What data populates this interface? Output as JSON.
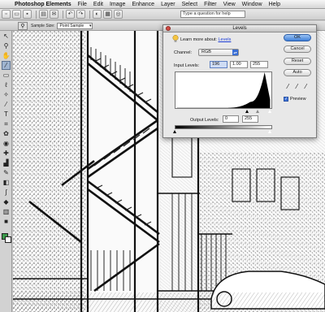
{
  "menubar": {
    "apple": "",
    "items": [
      "Photoshop Elements",
      "File",
      "Edit",
      "Image",
      "Enhance",
      "Layer",
      "Select",
      "Filter",
      "View",
      "Window",
      "Help"
    ]
  },
  "shortcuts": {
    "help_placeholder": "Type a question for help"
  },
  "options": {
    "sample_size_label": "Sample Size:",
    "sample_size_value": "Point Sample"
  },
  "levels": {
    "title": "Levels",
    "learn_more_prefix": "Learn more about:",
    "learn_more_link": "Levels",
    "channel_label": "Channel:",
    "channel_value": "RGB",
    "input_levels_label": "Input Levels:",
    "input_black": "196",
    "input_gamma": "1.00",
    "input_white": "255",
    "output_levels_label": "Output Levels:",
    "output_black": "0",
    "output_white": "255",
    "buttons": {
      "ok": "OK",
      "cancel": "Cancel",
      "reset": "Reset",
      "auto": "Auto"
    },
    "preview_label": "Preview",
    "preview_checked": true
  },
  "colors": {
    "accent": "#3a6fd6",
    "foreground": "#3a9a4a",
    "background": "#ffffff"
  }
}
